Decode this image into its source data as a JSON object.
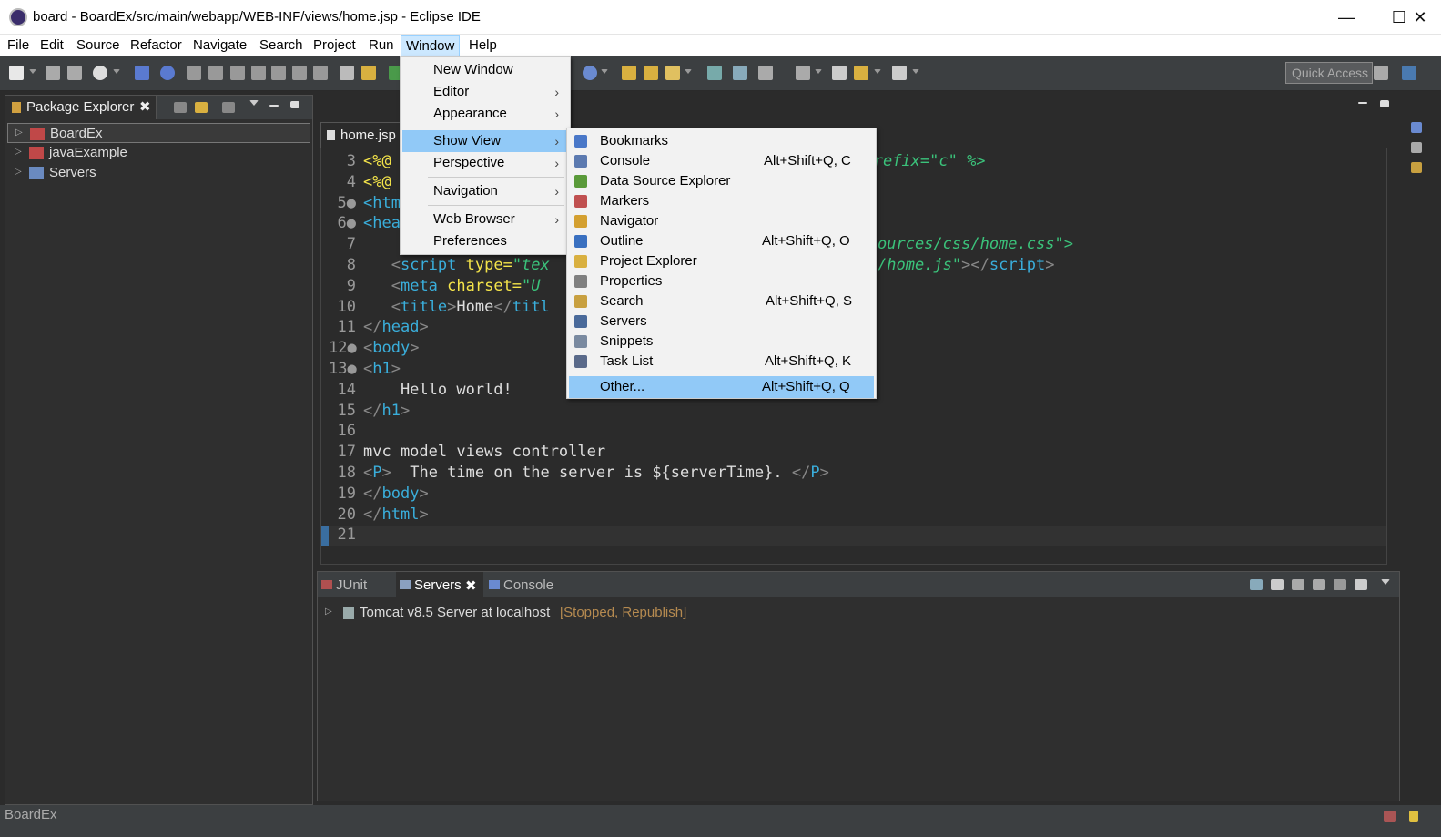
{
  "window": {
    "title": "board - BoardEx/src/main/webapp/WEB-INF/views/home.jsp - Eclipse IDE",
    "minimize": "—",
    "maximize": "☐",
    "close": "✕"
  },
  "menubar": [
    "File",
    "Edit",
    "Source",
    "Refactor",
    "Navigate",
    "Search",
    "Project",
    "Run",
    "Window",
    "Help"
  ],
  "toolbar": {
    "quick_access": "Quick Access"
  },
  "package_explorer": {
    "tab_label": "Package Explorer",
    "close": "✖",
    "projects": [
      "BoardEx",
      "javaExample",
      "Servers"
    ]
  },
  "editor": {
    "tab_label": "home.jsp",
    "lines": [
      {
        "num": "3"
      },
      {
        "num": "4"
      },
      {
        "num": "5●"
      },
      {
        "num": "6●"
      },
      {
        "num": "7"
      },
      {
        "num": "8"
      },
      {
        "num": "9"
      },
      {
        "num": "10"
      },
      {
        "num": "11"
      },
      {
        "num": "12●"
      },
      {
        "num": "13●"
      },
      {
        "num": "14"
      },
      {
        "num": "15"
      },
      {
        "num": "16"
      },
      {
        "num": "17"
      },
      {
        "num": "18"
      },
      {
        "num": "19"
      },
      {
        "num": "20"
      },
      {
        "num": "21"
      }
    ],
    "code": {
      "l3a": "<%@",
      "l3b": "refix=\"c\" %>",
      "l4a": "<%@",
      "l5a": "<htm",
      "l6a": "<hea",
      "l7b": "ources/css/home.css\">",
      "l8a": "script",
      "l8b": " type=",
      "l8c": "\"tex",
      "l8d": "/home.js\"",
      "l8e": "></",
      "l8f": "script",
      "l8g": ">",
      "l9a": "meta",
      "l9b": " charset=",
      "l9c": "\"U",
      "l10a": "title",
      "l10b": "Home",
      "l10c": "</",
      "l10d": "titl",
      "l11": "head",
      "l12": "body",
      "l13": "h1",
      "l14": "    Hello world!",
      "l15": "h1",
      "l17": "mvc model views controller",
      "l18a": "P",
      "l18b": "  The time on the server is ${serverTime}. ",
      "l18c": "P",
      "l19": "body",
      "l20": "html"
    }
  },
  "bottom_panel": {
    "tabs": [
      {
        "label": "JUnit"
      },
      {
        "label": "Servers",
        "close": "✖"
      },
      {
        "label": "Console"
      }
    ],
    "server": {
      "name": "Tomcat v8.5 Server at localhost",
      "status": "[Stopped, Republish]"
    }
  },
  "statusbar": {
    "text": "BoardEx"
  },
  "window_menu": {
    "items": [
      {
        "label": "New Window"
      },
      {
        "label": "Editor",
        "arrow": "›"
      },
      {
        "label": "Appearance",
        "arrow": "›"
      },
      {
        "label": "Show View",
        "arrow": "›"
      },
      {
        "label": "Perspective",
        "arrow": "›"
      },
      {
        "label": "Navigation",
        "arrow": "›"
      },
      {
        "label": "Web Browser",
        "arrow": "›"
      },
      {
        "label": "Preferences"
      }
    ]
  },
  "show_view_menu": {
    "items": [
      {
        "label": "Bookmarks",
        "shortcut": "",
        "icon_color": "#4a78c8"
      },
      {
        "label": "Console",
        "shortcut": "Alt+Shift+Q, C",
        "icon_color": "#5c7ab0"
      },
      {
        "label": "Data Source Explorer",
        "shortcut": "",
        "icon_color": "#5a9a3a"
      },
      {
        "label": "Markers",
        "shortcut": "",
        "icon_color": "#c05050"
      },
      {
        "label": "Navigator",
        "shortcut": "",
        "icon_color": "#d4a030"
      },
      {
        "label": "Outline",
        "shortcut": "Alt+Shift+Q, O",
        "icon_color": "#3a70c0"
      },
      {
        "label": "Project Explorer",
        "shortcut": "",
        "icon_color": "#d9b040"
      },
      {
        "label": "Properties",
        "shortcut": "",
        "icon_color": "#808080"
      },
      {
        "label": "Search",
        "shortcut": "Alt+Shift+Q, S",
        "icon_color": "#c8a040"
      },
      {
        "label": "Servers",
        "shortcut": "",
        "icon_color": "#4a6a9a"
      },
      {
        "label": "Snippets",
        "shortcut": "",
        "icon_color": "#7a8aa0"
      },
      {
        "label": "Task List",
        "shortcut": "Alt+Shift+Q, K",
        "icon_color": "#5a6a8a"
      },
      {
        "label": "Other...",
        "shortcut": "Alt+Shift+Q, Q",
        "icon_color": ""
      }
    ]
  }
}
